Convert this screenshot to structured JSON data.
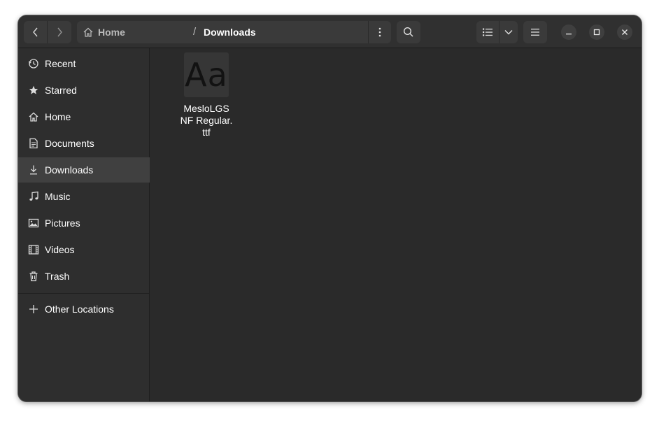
{
  "header": {
    "path": {
      "home_label": "Home",
      "separator": "/",
      "current": "Downloads"
    }
  },
  "sidebar": {
    "items": [
      {
        "label": "Recent",
        "icon": "clock-icon"
      },
      {
        "label": "Starred",
        "icon": "star-icon"
      },
      {
        "label": "Home",
        "icon": "home-icon"
      },
      {
        "label": "Documents",
        "icon": "document-icon"
      },
      {
        "label": "Downloads",
        "icon": "download-icon",
        "active": true
      },
      {
        "label": "Music",
        "icon": "music-note-icon"
      },
      {
        "label": "Pictures",
        "icon": "picture-icon"
      },
      {
        "label": "Videos",
        "icon": "film-icon"
      },
      {
        "label": "Trash",
        "icon": "trash-icon"
      }
    ],
    "other_locations": {
      "label": "Other Locations",
      "icon": "plus-icon"
    }
  },
  "content": {
    "files": [
      {
        "thumbnail_text": "Aa",
        "name_lines": [
          "MesloLGS",
          "NF Regular.",
          "ttf"
        ]
      }
    ]
  },
  "colors": {
    "window_bg": "#2a2a2a",
    "headerbar_bg": "#303030",
    "sidebar_bg": "#2e2e2e",
    "active_item_bg": "#404040",
    "button_bg": "#3a3a3a"
  }
}
